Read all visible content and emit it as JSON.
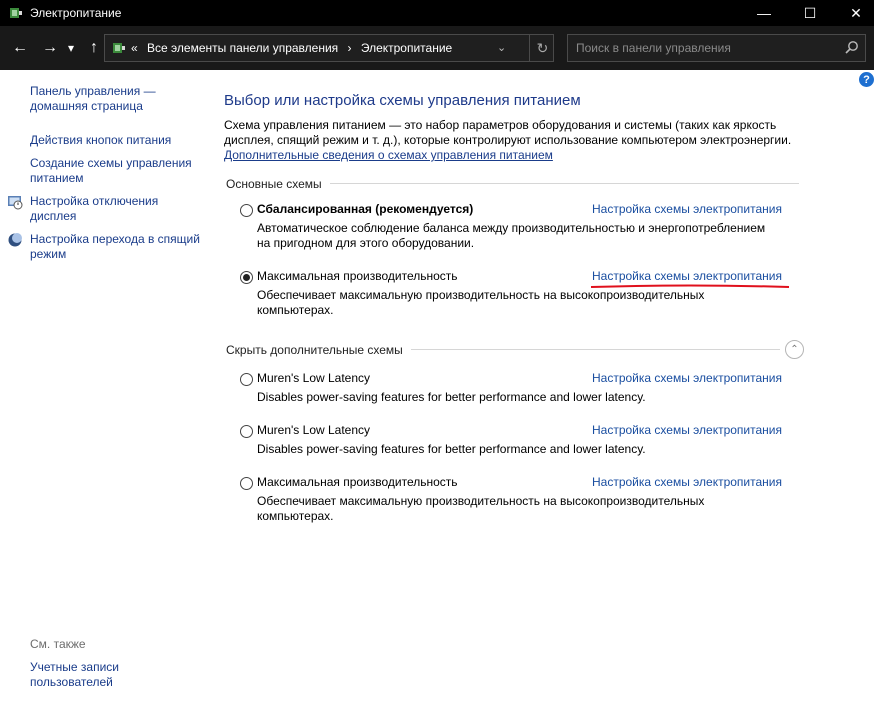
{
  "window": {
    "title": "Электропитание"
  },
  "titlebar": {
    "minimize": "—",
    "maximize": "☐",
    "close": "✕"
  },
  "nav": {
    "back": "←",
    "forward": "→",
    "dropdown": "▾",
    "up": "↑",
    "crumbs": [
      "«",
      "Все элементы панели управления",
      "›",
      "Электропитание"
    ],
    "addr_dropdown": "⌄",
    "refresh": "↻"
  },
  "search": {
    "placeholder": "Поиск в панели управления"
  },
  "left": {
    "links": [
      "Панель управления — домашняя страница",
      "Действия кнопок питания",
      "Создание схемы управления питанием",
      "Настройка отключения дисплея",
      "Настройка перехода в спящий режим"
    ],
    "see_also": "См. также",
    "user_accounts": "Учетные записи пользователей"
  },
  "help": "?",
  "main": {
    "title": "Выбор или настройка схемы управления питанием",
    "description": "Схема управления питанием — это набор параметров оборудования и системы (таких как яркость дисплея, спящий режим и т. д.), которые контролируют использование компьютером электроэнергии.",
    "more_link": "Дополнительные сведения о схемах управления питанием",
    "basic_group": "Основные схемы",
    "hidden_group": "Скрыть дополнительные схемы",
    "collapse": "⌃",
    "plans": [
      {
        "name": "Сбалансированная (рекомендуется)",
        "link": "Настройка схемы электропитания",
        "desc": "Автоматическое соблюдение баланса между производительностью и энергопотреблением на пригодном для этого оборудовании.",
        "checked": false
      },
      {
        "name": "Максимальная производительность",
        "link": "Настройка схемы электропитания",
        "desc": "Обеспечивает максимальную производительность на высокопроизводительных компьютерах.",
        "checked": true
      },
      {
        "name": "Muren's Low Latency",
        "link": "Настройка схемы электропитания",
        "desc": "Disables power-saving features for better performance and lower latency.",
        "checked": false
      },
      {
        "name": "Muren's Low Latency",
        "link": "Настройка схемы электропитания",
        "desc": "Disables power-saving features for better performance and lower latency.",
        "checked": false
      },
      {
        "name": "Максимальная производительность",
        "link": "Настройка схемы электропитания",
        "desc": "Обеспечивает максимальную производительность на высокопроизводительных компьютерах.",
        "checked": false
      }
    ]
  },
  "colors": {
    "link": "#1a4ea0",
    "title": "#1e3a8a",
    "annotation": "#e0101c"
  }
}
